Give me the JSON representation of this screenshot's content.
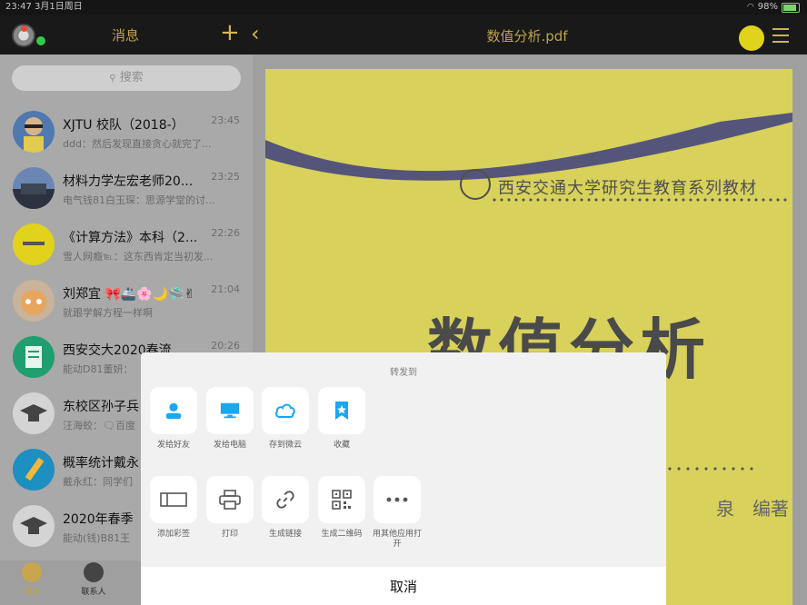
{
  "status_bar": {
    "time_date": "23:47  3月1日周日",
    "battery": "98%"
  },
  "topbar": {
    "messages_title": "消息",
    "document_title": "数值分析.pdf"
  },
  "sidebar": {
    "search_placeholder": "搜索",
    "chats": [
      {
        "name": "XJTU 校队（2018-）",
        "time": "23:45",
        "preview": "ddd：然后发现直接贪心就完了..."
      },
      {
        "name": "材料力学左宏老师20...",
        "time": "23:25",
        "preview": "电气钱81白玉琛：思源学堂的讨..."
      },
      {
        "name": "《计算方法》本科（2...",
        "time": "22:26",
        "preview": "雪人网瘾℡：这东西肯定当初发..."
      },
      {
        "name": "刘郑宜 🎀🚢🌸🌙🛸✌",
        "time": "21:04",
        "preview": "就跟学解方程一样啊"
      },
      {
        "name": "西安交大2020春流...",
        "time": "20:26",
        "preview": "能动D81董妍："
      },
      {
        "name": "东校区孙子兵",
        "time": "",
        "preview": "汪海蛟：🗨百度"
      },
      {
        "name": "概率统计戴永",
        "time": "",
        "preview": "戴永红：同学们"
      },
      {
        "name": "2020年春季",
        "time": "",
        "preview": "能动(钱)B81王"
      }
    ]
  },
  "bottom_nav": {
    "tabs": [
      {
        "label": "消息"
      },
      {
        "label": "联系人"
      }
    ]
  },
  "pdf": {
    "series": "西安交通大学研究生教育系列教材",
    "title": "数值分析",
    "author": "泉　编著"
  },
  "share_sheet": {
    "title": "转发到",
    "row1": [
      {
        "label": "发给好友",
        "icon": "person-icon"
      },
      {
        "label": "发给电脑",
        "icon": "computer-icon"
      },
      {
        "label": "存到微云",
        "icon": "cloud-icon"
      },
      {
        "label": "收藏",
        "icon": "bookmark-star-icon"
      }
    ],
    "row2": [
      {
        "label": "添加彩签",
        "icon": "tag-icon"
      },
      {
        "label": "打印",
        "icon": "printer-icon"
      },
      {
        "label": "生成链接",
        "icon": "link-icon"
      },
      {
        "label": "生成二维码",
        "icon": "qrcode-icon"
      },
      {
        "label": "用其他应用打开",
        "icon": "more-icon"
      }
    ],
    "cancel_label": "取消"
  },
  "colors": {
    "accent": "#d7b84c",
    "icon_blue": "#1aa7f0",
    "sheet_bg": "#f1f1f1"
  }
}
